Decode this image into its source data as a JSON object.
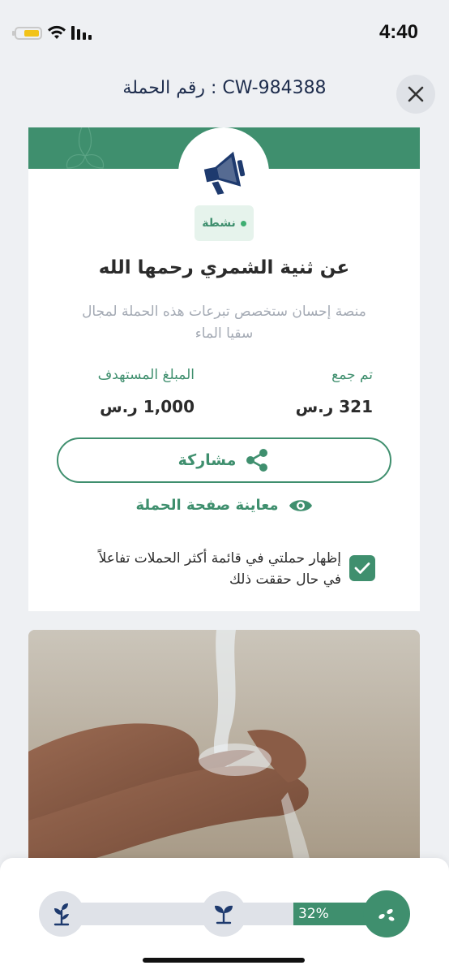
{
  "status_bar": {
    "time": "4:40"
  },
  "header": {
    "title": "رقم الحملة : CW-984388"
  },
  "campaign": {
    "status": "نشطة",
    "title": "عن ثنية الشمري رحمها الله",
    "description": "منصة إحسان ستخصص تبرعات هذه الحملة لمجال سقيا الماء",
    "collected_label": "تم جمع",
    "collected_value": "321 ر.س",
    "target_label": "المبلغ المستهدف",
    "target_value": "1,000 ر.س",
    "share_label": "مشاركة",
    "preview_label": "معاينة صفحة الحملة",
    "checkbox_label": "إظهار حملتي في قائمة أكثر الحملات تفاعلاً في حال حققت ذلك",
    "checkbox_checked": true
  },
  "progress": {
    "percent_text": "32%",
    "percent": 32
  },
  "colors": {
    "accent": "#3f8f6e",
    "navy": "#1e3a6e",
    "badge_bg": "#e6f3ec"
  },
  "icons": [
    "close-icon",
    "megaphone-icon",
    "share-icon",
    "eye-icon",
    "check-icon",
    "sprout-icon",
    "seedling-icon",
    "seeds-icon"
  ]
}
